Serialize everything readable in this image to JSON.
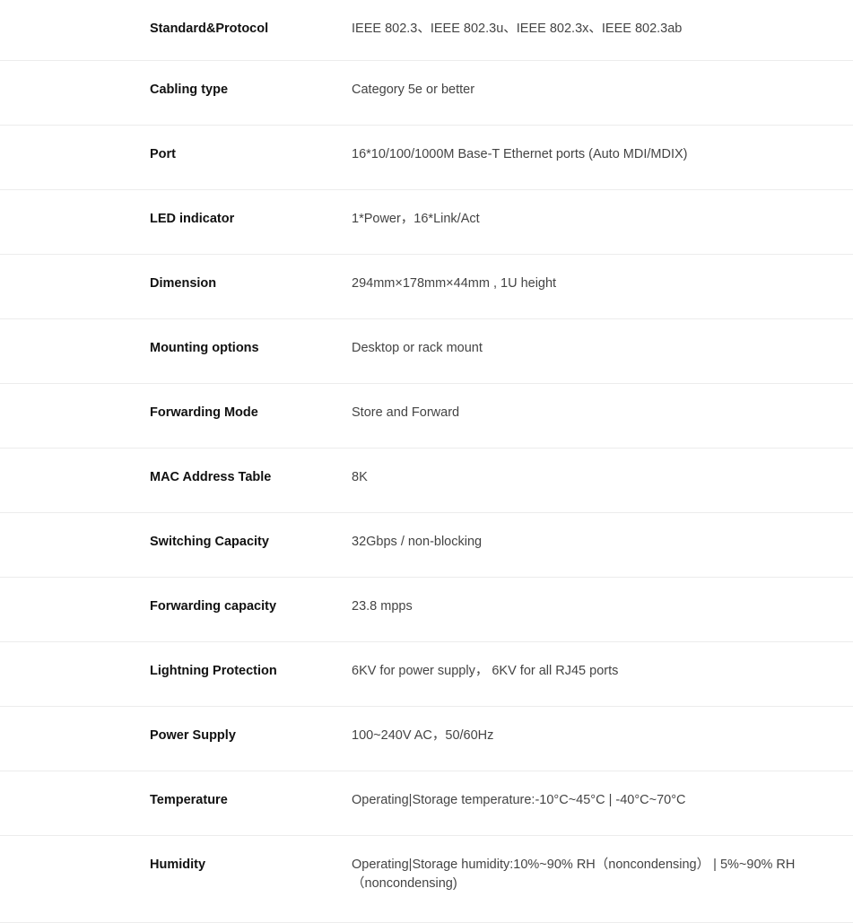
{
  "specs": [
    {
      "label": "Standard&Protocol",
      "value": "IEEE 802.3、IEEE 802.3u、IEEE 802.3x、IEEE 802.3ab"
    },
    {
      "label": "Cabling type",
      "value": "Category 5e or better"
    },
    {
      "label": "Port",
      "value": "16*10/100/1000M Base-T Ethernet ports (Auto MDI/MDIX)"
    },
    {
      "label": "LED indicator",
      "value": "1*Power，16*Link/Act"
    },
    {
      "label": "Dimension",
      "value": "294mm×178mm×44mm , 1U height"
    },
    {
      "label": "Mounting options",
      "value": "Desktop or rack mount"
    },
    {
      "label": "Forwarding Mode",
      "value": "Store and Forward"
    },
    {
      "label": "MAC Address Table",
      "value": "8K"
    },
    {
      "label": "Switching Capacity",
      "value": "32Gbps / non-blocking"
    },
    {
      "label": "Forwarding capacity",
      "value": "23.8 mpps"
    },
    {
      "label": "Lightning Protection",
      "value": "6KV for power supply， 6KV for all RJ45 ports"
    },
    {
      "label": "Power Supply",
      "value": "100~240V AC，50/60Hz"
    },
    {
      "label": "Temperature",
      "value": "Operating|Storage temperature:-10°C~45°C | -40°C~70°C"
    },
    {
      "label": "Humidity",
      "value": "Operating|Storage humidity:10%~90% RH（noncondensing） | 5%~90% RH （noncondensing)"
    }
  ]
}
